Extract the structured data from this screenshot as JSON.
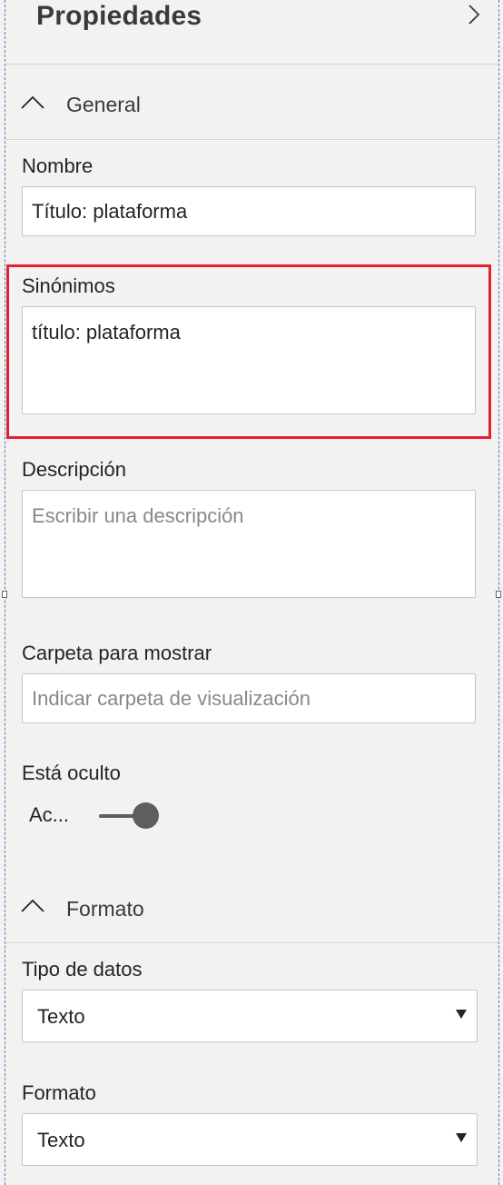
{
  "header": {
    "title": "Propiedades"
  },
  "general": {
    "title": "General",
    "name": {
      "label": "Nombre",
      "value": "Título: plataforma"
    },
    "synonyms": {
      "label": "Sinónimos",
      "value": "título: plataforma"
    },
    "description": {
      "label": "Descripción",
      "placeholder": "Escribir una descripción"
    },
    "folder": {
      "label": "Carpeta para mostrar",
      "placeholder": "Indicar carpeta de visualización"
    },
    "hidden": {
      "label": "Está oculto",
      "state_label": "Ac..."
    }
  },
  "format": {
    "title": "Formato",
    "data_type": {
      "label": "Tipo de datos",
      "value": "Texto"
    },
    "format": {
      "label": "Formato",
      "value": "Texto"
    }
  },
  "colors": {
    "highlight": "#e3202c",
    "selection": "#4a7fc9"
  }
}
